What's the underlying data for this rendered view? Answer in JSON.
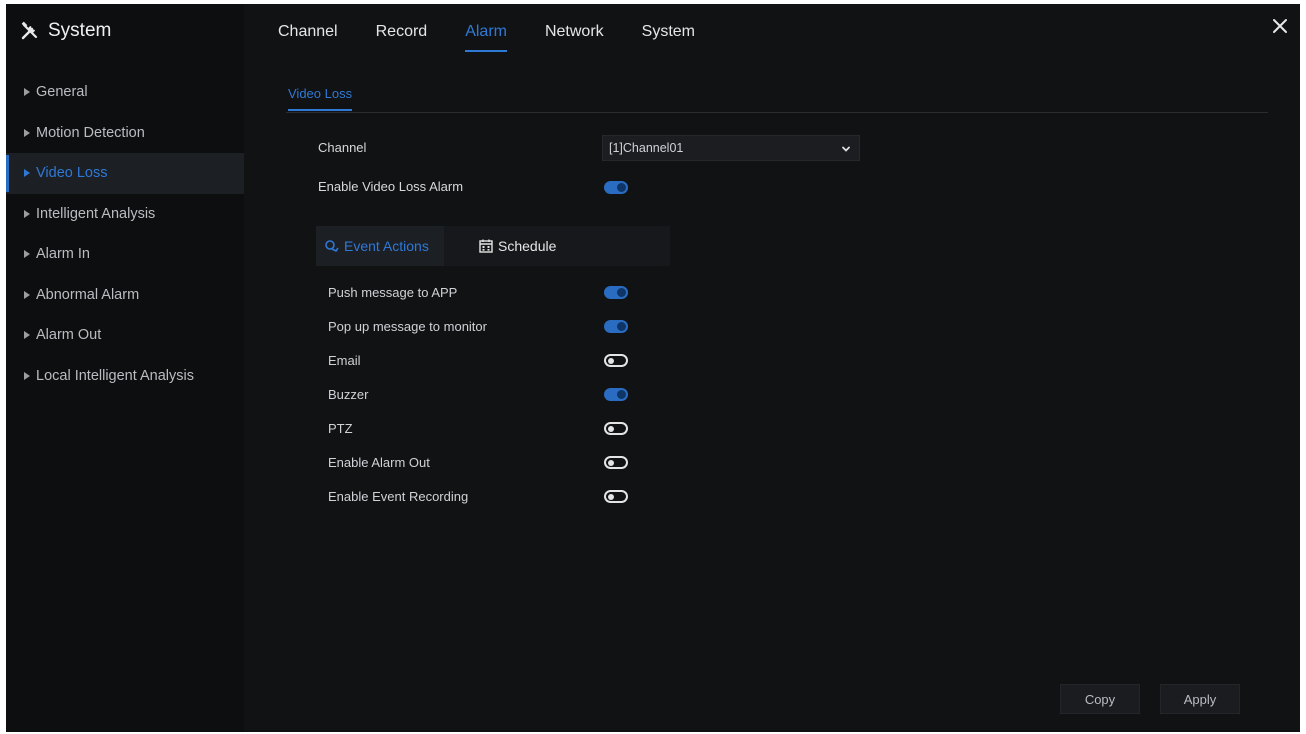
{
  "app": {
    "title": "System"
  },
  "sidebar": {
    "items": [
      {
        "label": "General"
      },
      {
        "label": "Motion Detection"
      },
      {
        "label": "Video Loss",
        "active": true
      },
      {
        "label": "Intelligent Analysis"
      },
      {
        "label": "Alarm In"
      },
      {
        "label": "Abnormal Alarm"
      },
      {
        "label": "Alarm Out"
      },
      {
        "label": "Local Intelligent Analysis"
      }
    ]
  },
  "topnav": {
    "tabs": [
      {
        "label": "Channel"
      },
      {
        "label": "Record"
      },
      {
        "label": "Alarm",
        "active": true
      },
      {
        "label": "Network"
      },
      {
        "label": "System"
      }
    ]
  },
  "subtab": {
    "label": "Video Loss"
  },
  "form": {
    "channel_label": "Channel",
    "channel_value": "[1]Channel01",
    "enable_label": "Enable Video Loss Alarm",
    "enable_on": true
  },
  "action_tabs": {
    "event_actions": "Event Actions",
    "schedule": "Schedule"
  },
  "actions": [
    {
      "label": "Push message to APP",
      "on": true
    },
    {
      "label": "Pop up message to monitor",
      "on": true
    },
    {
      "label": "Email",
      "on": false
    },
    {
      "label": "Buzzer",
      "on": true
    },
    {
      "label": "PTZ",
      "on": false
    },
    {
      "label": "Enable Alarm Out",
      "on": false
    },
    {
      "label": "Enable Event Recording",
      "on": false
    }
  ],
  "buttons": {
    "copy": "Copy",
    "apply": "Apply"
  },
  "colors": {
    "accent": "#2f79d6",
    "background": "#111214",
    "sidebar": "#0d0e10"
  }
}
